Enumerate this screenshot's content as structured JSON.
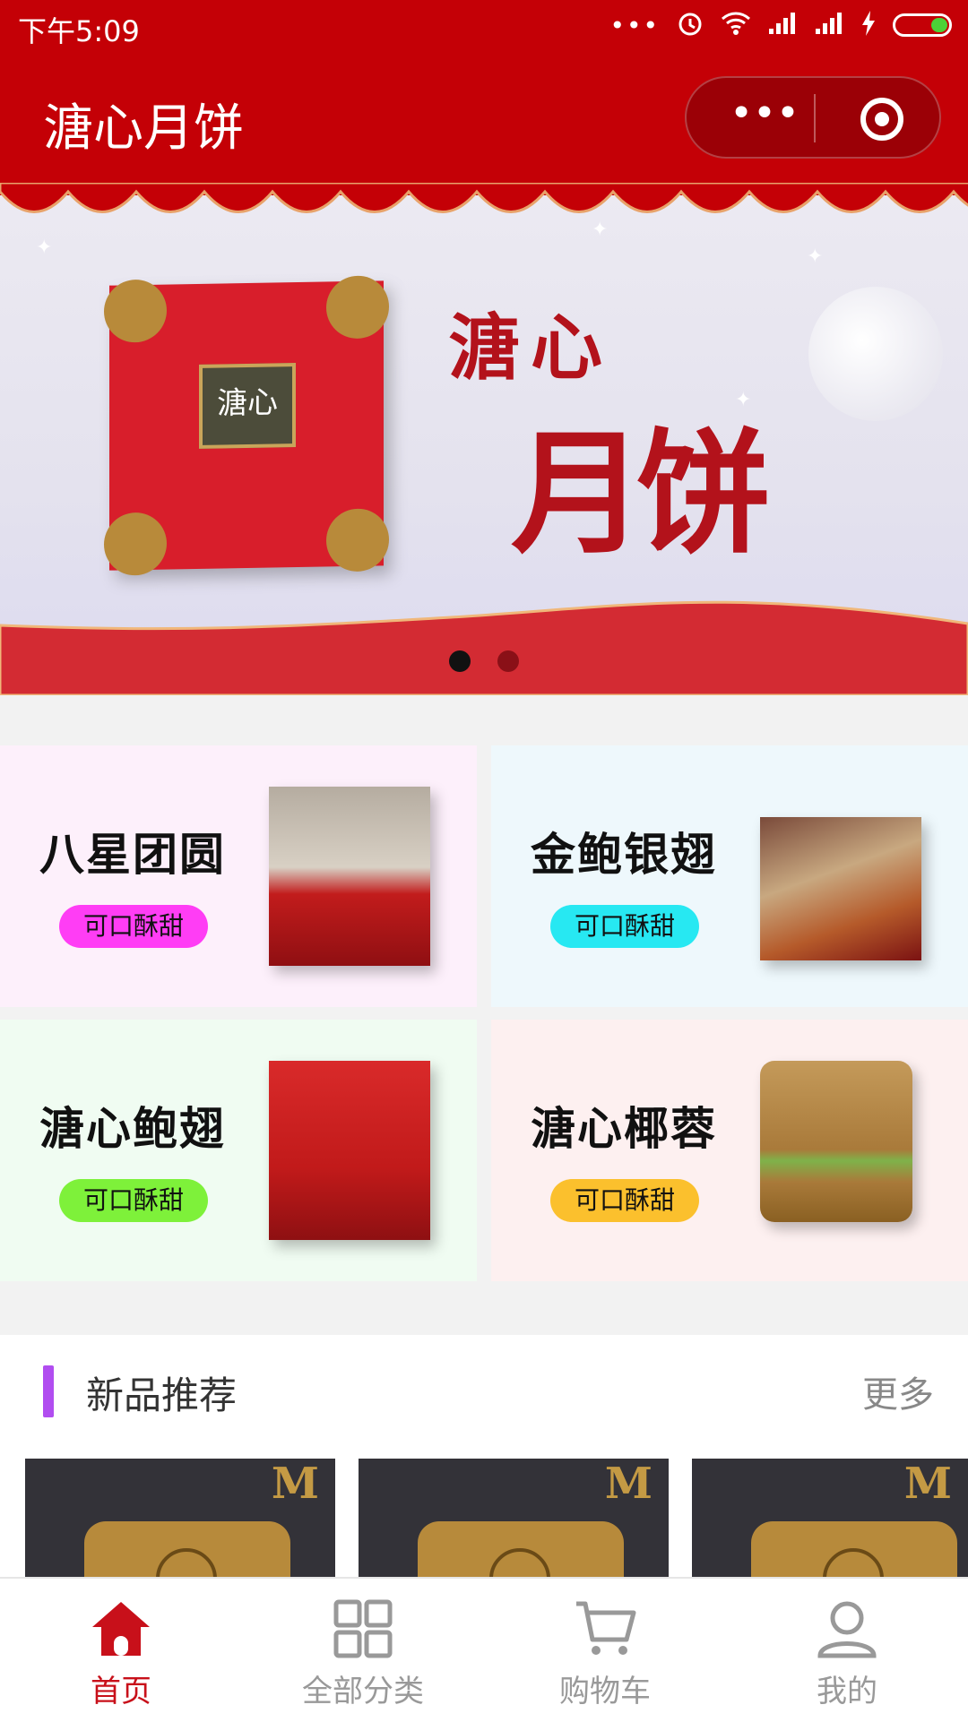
{
  "status_bar": {
    "time": "下午5:09"
  },
  "nav": {
    "title": "溏心月饼"
  },
  "banner": {
    "calligraphy_line1": "溏心",
    "calligraphy_line2": "月饼",
    "box_label": "溏心",
    "page_count": 2,
    "active_index": 0
  },
  "categories": [
    {
      "name": "八星团圆",
      "tag": "可口酥甜",
      "tag_color": "#ff3df5",
      "bg": "#fdf0fb"
    },
    {
      "name": "金鲍银翅",
      "tag": "可口酥甜",
      "tag_color": "#27e8f2",
      "bg": "#eef8fc"
    },
    {
      "name": "溏心鲍翅",
      "tag": "可口酥甜",
      "tag_color": "#7ef13a",
      "bg": "#f0fcf2"
    },
    {
      "name": "溏心椰蓉",
      "tag": "可口酥甜",
      "tag_color": "#fbc02d",
      "bg": "#fdf0f0"
    }
  ],
  "new_products": {
    "title": "新品推荐",
    "more": "更多"
  },
  "tabbar": {
    "items": [
      {
        "label": "首页",
        "icon": "home-icon",
        "active": true
      },
      {
        "label": "全部分类",
        "icon": "grid-icon",
        "active": false
      },
      {
        "label": "购物车",
        "icon": "cart-icon",
        "active": false
      },
      {
        "label": "我的",
        "icon": "user-icon",
        "active": false
      }
    ]
  },
  "colors": {
    "brand_red": "#c40006",
    "active_tab": "#c8101a",
    "section_accent": "#b14df0"
  }
}
